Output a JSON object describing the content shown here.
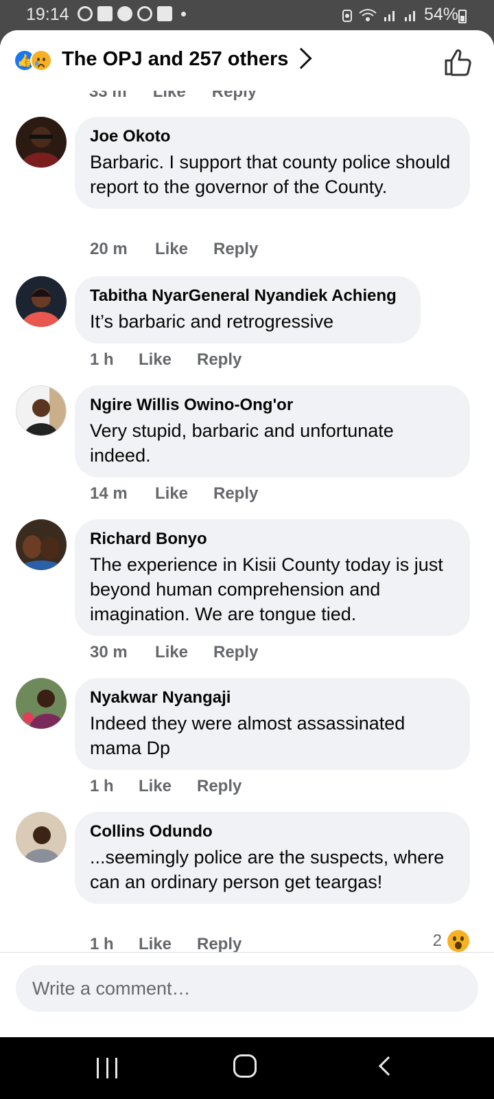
{
  "status_bar": {
    "time": "19:14",
    "battery": "54%"
  },
  "header": {
    "title": "The OPJ and 257 others"
  },
  "scroll_remnant": {
    "time": "33 m",
    "like": "Like",
    "reply": "Reply"
  },
  "comments": [
    {
      "name": "Joe Okoto",
      "text": "Barbaric. I support that county police should report to the governor of the County.",
      "time": "20 m",
      "like": "Like",
      "reply": "Reply"
    },
    {
      "name": "Tabitha NyarGeneral Nyandiek Achieng",
      "text": "It’s barbaric and retrogressive",
      "time": "1 h",
      "like": "Like",
      "reply": "Reply"
    },
    {
      "name": "Ngire Willis Owino-Ong'or",
      "text": "Very stupid, barbaric and unfortunate indeed.",
      "time": "14 m",
      "like": "Like",
      "reply": "Reply"
    },
    {
      "name": "Richard Bonyo",
      "text": "The experience in Kisii County today is just beyond human comprehension and imagination. We are tongue tied.",
      "time": "30 m",
      "like": "Like",
      "reply": "Reply"
    },
    {
      "name": "Nyakwar Nyangaji",
      "text": "Indeed they were almost assassinated mama Dp",
      "time": "1 h",
      "like": "Like",
      "reply": "Reply"
    },
    {
      "name": "Collins Odundo",
      "text": "...seemingly police are the suspects, where can an  ordinary person get teargas!",
      "time": "1 h",
      "like": "Like",
      "reply": "Reply",
      "reaction_count": "2"
    }
  ],
  "composer": {
    "placeholder": "Write a comment…"
  },
  "colors": {
    "accent": "#1877f2",
    "bubble": "#f0f2f5",
    "meta": "#65676b"
  }
}
